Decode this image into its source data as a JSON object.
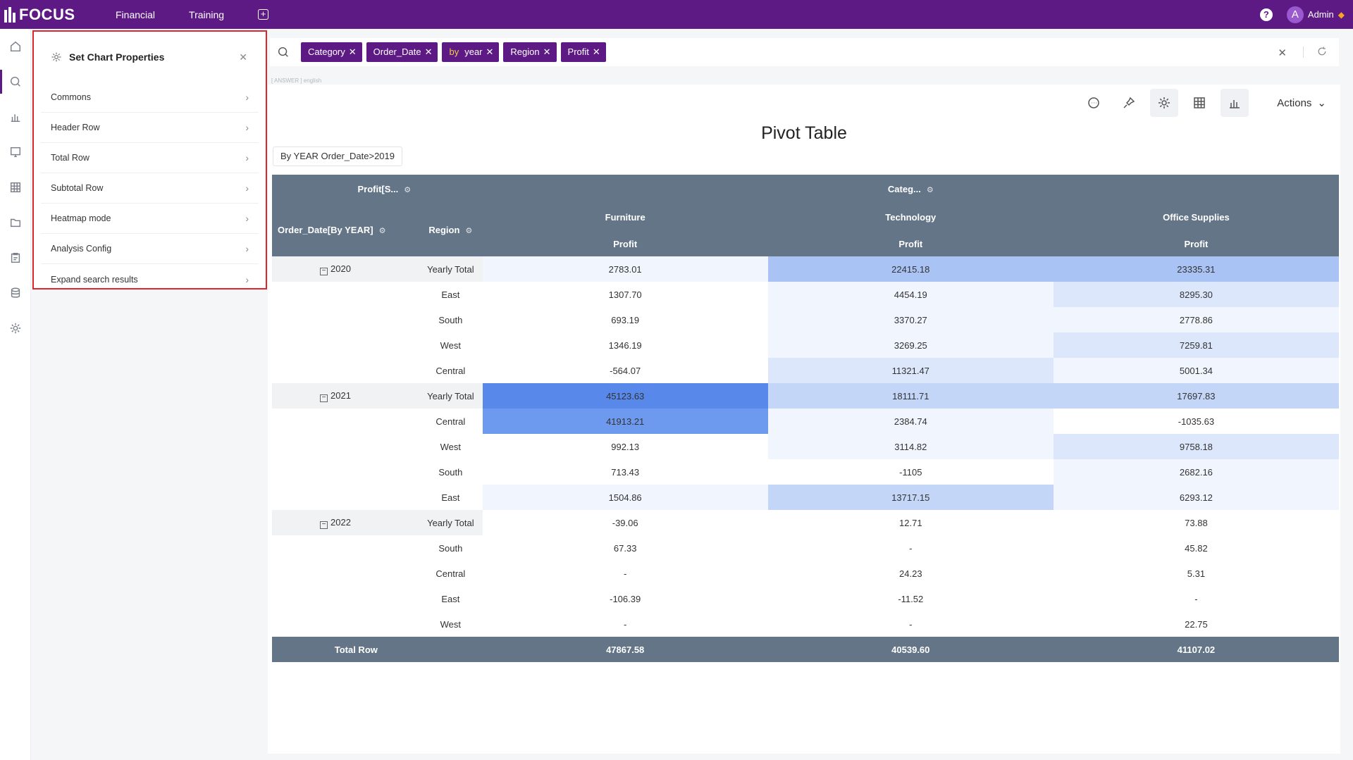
{
  "app": {
    "logo_text": "FOCUS",
    "nav": [
      "Financial",
      "Training"
    ],
    "user": {
      "initial": "A",
      "name": "Admin"
    }
  },
  "props_panel": {
    "title": "Set Chart Properties",
    "items": [
      "Commons",
      "Header Row",
      "Total Row",
      "Subtotal Row",
      "Heatmap mode",
      "Analysis Config",
      "Expand search results"
    ]
  },
  "search": {
    "tags": [
      {
        "label": "Category"
      },
      {
        "label": "Order_Date"
      },
      {
        "prefix": "by",
        "label": "year"
      },
      {
        "label": "Region"
      },
      {
        "label": "Profit"
      }
    ],
    "hint": "[ ANSWER ] english"
  },
  "toolbar": {
    "actions_label": "Actions"
  },
  "chart": {
    "title": "Pivot Table",
    "filter": "By YEAR Order_Date>2019"
  },
  "pivot": {
    "measure_header": "Profit[S...",
    "column_dim_header": "Categ...",
    "row_headers": [
      "Order_Date[By YEAR]",
      "Region"
    ],
    "categories": [
      "Furniture",
      "Technology",
      "Office Supplies"
    ],
    "measure": "Profit",
    "groups": [
      {
        "year": "2020",
        "rows": [
          {
            "region": "Yearly Total",
            "values": [
              "2783.01",
              "22415.18",
              "23335.31"
            ],
            "heat": [
              1,
              4,
              4
            ]
          },
          {
            "region": "East",
            "values": [
              "1307.70",
              "4454.19",
              "8295.30"
            ],
            "heat": [
              0,
              1,
              2
            ]
          },
          {
            "region": "South",
            "values": [
              "693.19",
              "3370.27",
              "2778.86"
            ],
            "heat": [
              0,
              1,
              1
            ]
          },
          {
            "region": "West",
            "values": [
              "1346.19",
              "3269.25",
              "7259.81"
            ],
            "heat": [
              0,
              1,
              2
            ]
          },
          {
            "region": "Central",
            "values": [
              "-564.07",
              "11321.47",
              "5001.34"
            ],
            "heat": [
              0,
              2,
              1
            ]
          }
        ]
      },
      {
        "year": "2021",
        "rows": [
          {
            "region": "Yearly Total",
            "values": [
              "45123.63",
              "18111.71",
              "17697.83"
            ],
            "heat": [
              6,
              3,
              3
            ]
          },
          {
            "region": "Central",
            "values": [
              "41913.21",
              "2384.74",
              "-1035.63"
            ],
            "heat": [
              5,
              1,
              0
            ]
          },
          {
            "region": "West",
            "values": [
              "992.13",
              "3114.82",
              "9758.18"
            ],
            "heat": [
              0,
              1,
              2
            ]
          },
          {
            "region": "South",
            "values": [
              "713.43",
              "-1105",
              "2682.16"
            ],
            "heat": [
              0,
              0,
              1
            ]
          },
          {
            "region": "East",
            "values": [
              "1504.86",
              "13717.15",
              "6293.12"
            ],
            "heat": [
              1,
              3,
              1
            ]
          }
        ]
      },
      {
        "year": "2022",
        "rows": [
          {
            "region": "Yearly Total",
            "values": [
              "-39.06",
              "12.71",
              "73.88"
            ],
            "heat": [
              0,
              0,
              0
            ]
          },
          {
            "region": "South",
            "values": [
              "67.33",
              "-",
              "45.82"
            ],
            "heat": [
              0,
              0,
              0
            ]
          },
          {
            "region": "Central",
            "values": [
              "-",
              "24.23",
              "5.31"
            ],
            "heat": [
              0,
              0,
              0
            ]
          },
          {
            "region": "East",
            "values": [
              "-106.39",
              "-11.52",
              "-"
            ],
            "heat": [
              0,
              0,
              0
            ]
          },
          {
            "region": "West",
            "values": [
              "-",
              "-",
              "22.75"
            ],
            "heat": [
              0,
              0,
              0
            ]
          }
        ]
      }
    ],
    "total_row": {
      "label": "Total Row",
      "values": [
        "47867.58",
        "40539.60",
        "41107.02"
      ]
    }
  },
  "colors": {
    "brand": "#5e1a84",
    "header": "#647588",
    "highlight": "#e0262b",
    "negative": "#e0262b"
  }
}
